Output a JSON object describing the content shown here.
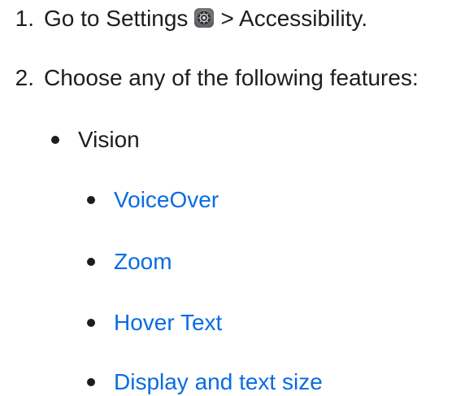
{
  "steps": [
    {
      "number": "1.",
      "text_before": "Go to Settings",
      "icon": "settings-gear-icon",
      "text_after": "> Accessibility."
    },
    {
      "number": "2.",
      "text": "Choose any of the following features:"
    }
  ],
  "categories": [
    {
      "label": "Vision",
      "links": [
        {
          "label": "VoiceOver"
        },
        {
          "label": "Zoom"
        },
        {
          "label": "Hover Text"
        },
        {
          "label": "Display and text size"
        }
      ]
    }
  ],
  "colors": {
    "text": "#1d1d1f",
    "link": "#0a6ce0"
  }
}
